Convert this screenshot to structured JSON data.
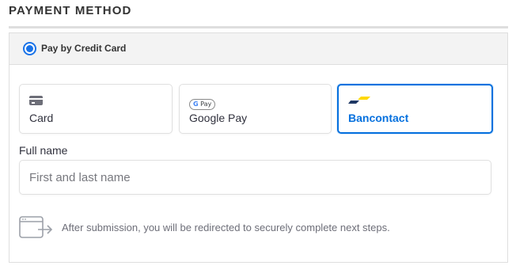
{
  "section": {
    "title": "PAYMENT METHOD"
  },
  "method": {
    "label": "Pay by Credit Card",
    "selected": true
  },
  "tabs": [
    {
      "label": "Card",
      "icon": "credit-card-icon",
      "selected": false
    },
    {
      "label": "Google Pay",
      "icon": "google-pay-icon",
      "badge_g": "G",
      "badge_text": "Pay",
      "selected": false
    },
    {
      "label": "Bancontact",
      "icon": "bancontact-icon",
      "selected": true
    }
  ],
  "full_name": {
    "label": "Full name",
    "placeholder": "First and last name",
    "value": ""
  },
  "redirect_note": {
    "icon": "browser-redirect-icon",
    "text": "After submission, you will be redirected to securely complete next steps."
  },
  "colors": {
    "accent": "#0570de",
    "radio": "#1a73e8",
    "bancontact_blue": "#1e3764",
    "bancontact_yellow": "#ffd800"
  }
}
